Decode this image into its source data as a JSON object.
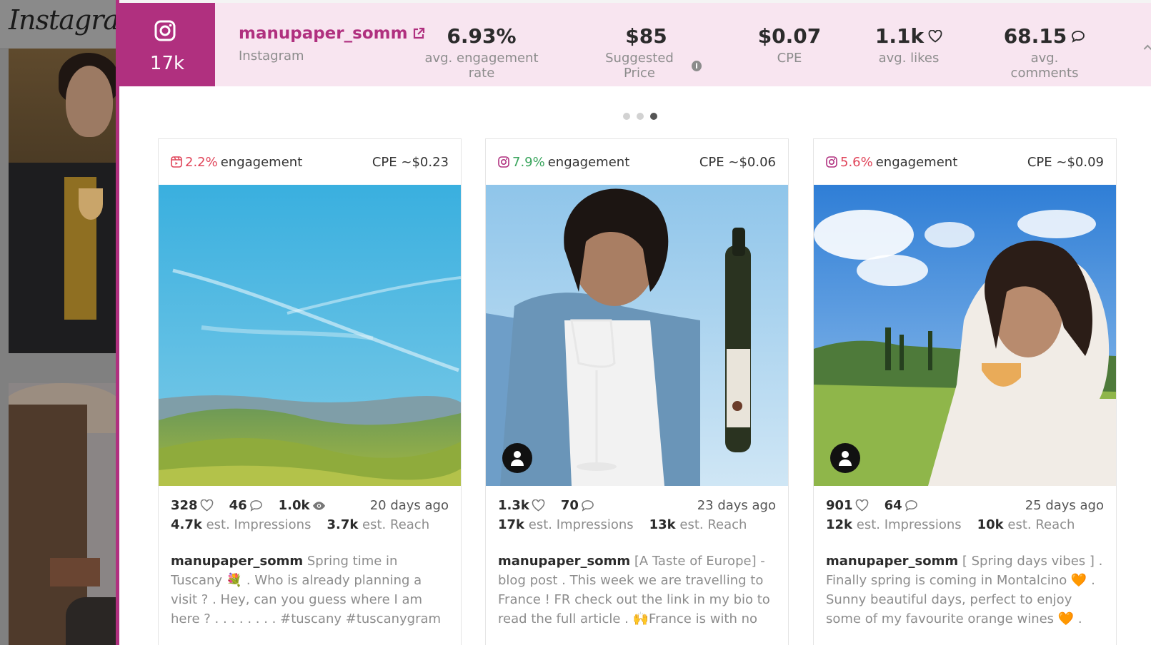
{
  "background": {
    "logo_text": "Instagram"
  },
  "profile": {
    "followers": "17k",
    "handle": "manupaper_somm",
    "platform": "Instagram"
  },
  "stats": [
    {
      "value": "6.93%",
      "label": "avg. engagement rate",
      "icon": ""
    },
    {
      "value": "$85",
      "label": "Suggested Price",
      "icon": "info-icon"
    },
    {
      "value": "$0.07",
      "label": "CPE",
      "icon": ""
    },
    {
      "value": "1.1k",
      "label": "avg. likes",
      "icon": "heart-icon"
    },
    {
      "value": "68.15",
      "label": "avg. comments",
      "icon": "comment-icon"
    }
  ],
  "carousel": {
    "dots": 3,
    "active_index": 2
  },
  "posts": [
    {
      "type_icon": "reel-icon",
      "engagement": "2.2%",
      "engagement_label": "engagement",
      "engagement_color": "#e0455a",
      "cpe": "CPE ~$0.23",
      "likes": "328",
      "comments": "46",
      "views": "1.0k",
      "date": "20 days ago",
      "impressions": "4.7k",
      "impressions_label": "est. Impressions",
      "reach": "3.7k",
      "reach_label": "est. Reach",
      "author": "manupaper_somm",
      "caption": "Spring time in Tuscany 💐 . Who is already planning a visit ? . Hey, can you guess where I am here ? . . . . . . . . #tuscany #tuscanygram #tuscanylovers #tuscanyitaly..."
    },
    {
      "type_icon": "instagram-icon",
      "engagement": "7.9%",
      "engagement_label": "engagement",
      "engagement_color": "#3aa55d",
      "cpe": "CPE ~$0.06",
      "likes": "1.3k",
      "comments": "70",
      "views": "",
      "date": "23 days ago",
      "impressions": "17k",
      "impressions_label": "est. Impressions",
      "reach": "13k",
      "reach_label": "est. Reach",
      "author": "manupaper_somm",
      "caption": "[A Taste of Europe] - blog post . This week we are travelling to France ! FR check out the link in my bio to read the full article . 🙌France is with no arguments the..."
    },
    {
      "type_icon": "instagram-icon",
      "engagement": "5.6%",
      "engagement_label": "engagement",
      "engagement_color": "#e0455a",
      "cpe": "CPE ~$0.09",
      "likes": "901",
      "comments": "64",
      "views": "",
      "date": "25 days ago",
      "impressions": "12k",
      "impressions_label": "est. Impressions",
      "reach": "10k",
      "reach_label": "est. Reach",
      "author": "manupaper_somm",
      "caption": "[ Spring days vibes ] . Finally spring is coming in Montalcino 🧡 . Sunny beautiful days, perfect to enjoy some of my favourite orange wines 🧡 . Weekend is..."
    }
  ],
  "colors": {
    "brand": "#b0307f",
    "bar_bg": "#f8e5f0"
  }
}
